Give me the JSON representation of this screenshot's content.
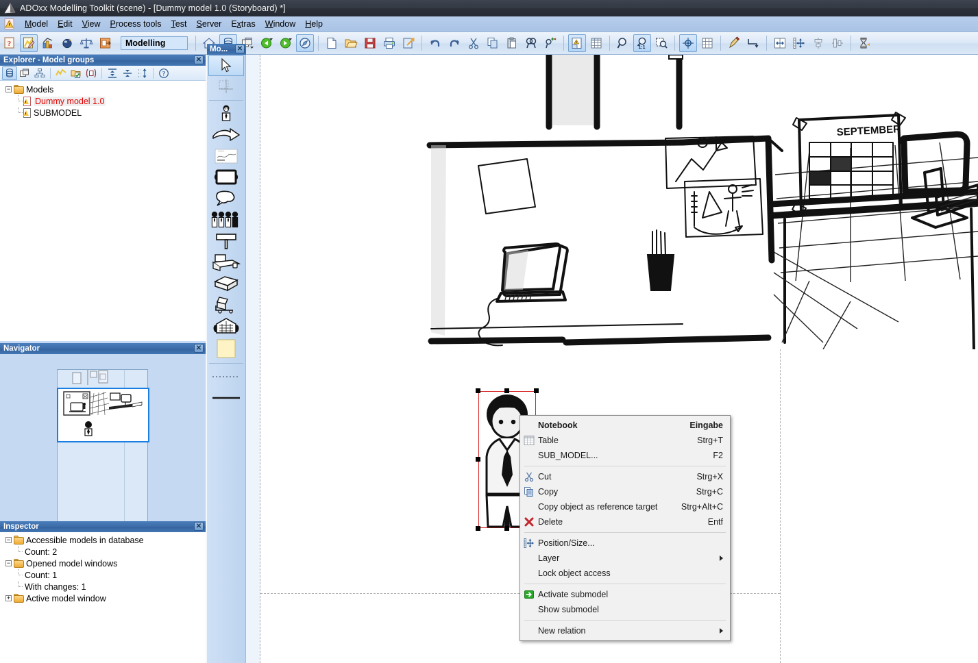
{
  "window": {
    "title": "ADOxx Modelling Toolkit (scene) - [Dummy model 1.0 (Storyboard) *]",
    "app_icon": "adoxx-logo-icon"
  },
  "menubar": {
    "items": [
      {
        "label": "Model",
        "accesskey": "M"
      },
      {
        "label": "Edit",
        "accesskey": "E"
      },
      {
        "label": "View",
        "accesskey": "V"
      },
      {
        "label": "Process tools",
        "accesskey": "P"
      },
      {
        "label": "Test",
        "accesskey": "T"
      },
      {
        "label": "Server",
        "accesskey": "S"
      },
      {
        "label": "Extras",
        "accesskey": "x"
      },
      {
        "label": "Window",
        "accesskey": "W"
      },
      {
        "label": "Help",
        "accesskey": "H"
      }
    ]
  },
  "toolbar": {
    "mode_label": "Modelling",
    "groups": [
      {
        "buttons": [
          {
            "name": "info-component-icon",
            "active": false
          },
          {
            "name": "modelling-component-icon",
            "active": true
          },
          {
            "name": "analysis-component-icon",
            "active": false
          },
          {
            "name": "simulation-component-icon",
            "active": false
          },
          {
            "name": "evaluation-component-icon",
            "active": false
          },
          {
            "name": "import-export-component-icon",
            "active": false
          }
        ]
      },
      {
        "buttons": [
          {
            "name": "home-icon",
            "active": false
          },
          {
            "name": "model-database-icon",
            "active": true
          },
          {
            "name": "model-windows-icon",
            "active": false
          },
          {
            "name": "navigate-back-icon",
            "active": false
          },
          {
            "name": "navigate-forward-icon",
            "active": false
          },
          {
            "name": "navigator-toggle-icon",
            "active": true
          }
        ]
      },
      {
        "buttons": [
          {
            "name": "new-model-icon",
            "active": false
          },
          {
            "name": "open-model-icon",
            "active": false
          },
          {
            "name": "save-model-icon",
            "active": false
          },
          {
            "name": "print-model-icon",
            "active": false
          },
          {
            "name": "export-model-icon",
            "active": false
          }
        ]
      },
      {
        "buttons": [
          {
            "name": "undo-icon",
            "active": false
          },
          {
            "name": "redo-icon",
            "active": false
          },
          {
            "name": "cut-icon",
            "active": false
          },
          {
            "name": "copy-icon",
            "active": false
          },
          {
            "name": "paste-icon",
            "active": false
          },
          {
            "name": "search-icon",
            "active": false
          },
          {
            "name": "replace-icon",
            "active": false
          }
        ]
      },
      {
        "buttons": [
          {
            "name": "notebook-icon",
            "active": true
          },
          {
            "name": "table-view-icon",
            "active": false
          }
        ]
      },
      {
        "buttons": [
          {
            "name": "zoom-icon",
            "active": false
          },
          {
            "name": "zoom-actual-size-icon",
            "active": true
          },
          {
            "name": "zoom-region-icon",
            "active": false
          }
        ]
      },
      {
        "buttons": [
          {
            "name": "snap-to-grid-icon",
            "active": true
          },
          {
            "name": "show-grid-icon",
            "active": false
          }
        ]
      },
      {
        "buttons": [
          {
            "name": "draw-pen-icon",
            "active": false
          },
          {
            "name": "connector-icon",
            "active": false
          }
        ]
      },
      {
        "buttons": [
          {
            "name": "align-width-icon",
            "active": false
          },
          {
            "name": "distribute-icon",
            "active": false
          },
          {
            "name": "align-center-v-icon",
            "active": false
          },
          {
            "name": "align-center-h-icon",
            "active": false
          }
        ]
      },
      {
        "buttons": [
          {
            "name": "generate-report-icon",
            "active": false
          }
        ]
      }
    ]
  },
  "explorer": {
    "caption": "Explorer - Model groups",
    "close_label": "✕",
    "toolbar_buttons": [
      {
        "name": "model-groups-icon",
        "active": true
      },
      {
        "name": "model-windows-icon",
        "active": false
      },
      {
        "name": "model-hierarchy-icon",
        "active": false
      },
      {
        "name": "quick-access-icon",
        "active": false
      },
      {
        "name": "open-model-check-icon",
        "active": false
      },
      {
        "name": "copy-model-icon",
        "active": false
      },
      {
        "name": "expand-all-icon",
        "active": false
      },
      {
        "name": "collapse-all-icon",
        "active": false
      },
      {
        "name": "refresh-tree-icon",
        "active": false
      },
      {
        "name": "help-icon",
        "active": false
      }
    ],
    "tree": [
      {
        "label": "Models",
        "type": "folder",
        "expander": "−",
        "level": 0,
        "selected": false
      },
      {
        "label": "Dummy model 1.0",
        "type": "model",
        "expander": "",
        "level": 1,
        "selected": true
      },
      {
        "label": "SUBMODEL",
        "type": "model",
        "expander": "",
        "level": 1,
        "selected": false
      }
    ]
  },
  "navigator": {
    "caption": "Navigator",
    "close_label": "✕"
  },
  "inspector": {
    "caption": "Inspector",
    "close_label": "✕",
    "tree": [
      {
        "label": "Accessible models in database",
        "type": "folder",
        "expander": "−",
        "level": 0
      },
      {
        "label": "Count: 2",
        "type": "leaf",
        "expander": "",
        "level": 1
      },
      {
        "label": "Opened model windows",
        "type": "folder",
        "expander": "−",
        "level": 0
      },
      {
        "label": "Count: 1",
        "type": "leaf",
        "expander": "",
        "level": 1
      },
      {
        "label": "With changes: 1",
        "type": "leaf",
        "expander": "",
        "level": 1
      },
      {
        "label": "Active model window",
        "type": "folder",
        "expander": "+",
        "level": 0
      }
    ]
  },
  "palette": {
    "caption": "Mo...",
    "close_label": "✕",
    "items": [
      {
        "name": "pointer-tool-icon",
        "selected": true
      },
      {
        "name": "bendpoint-tool-icon",
        "selected": false
      },
      {
        "name": "actor-person-icon",
        "selected": false
      },
      {
        "name": "arrow-shape-icon",
        "selected": false
      },
      {
        "name": "scene-image-icon",
        "selected": false
      },
      {
        "name": "screen-frame-icon",
        "selected": false
      },
      {
        "name": "speech-bubble-icon",
        "selected": false
      },
      {
        "name": "actor-group-icon",
        "selected": false
      },
      {
        "name": "signpost-icon",
        "selected": false
      },
      {
        "name": "workplace-desk-icon",
        "selected": false
      },
      {
        "name": "box-package-icon",
        "selected": false
      },
      {
        "name": "trolley-icon",
        "selected": false
      },
      {
        "name": "building-icon",
        "selected": false
      },
      {
        "name": "sticky-note-icon",
        "selected": false
      },
      {
        "name": "dashed-relation-icon",
        "selected": false
      },
      {
        "name": "solid-relation-icon",
        "selected": false
      }
    ]
  },
  "canvas": {
    "model_name": "Dummy model 1.0 (Storyboard)",
    "selected_object": "actor-person-object",
    "scene_labels": {
      "calendar_month": "SEPTEMBER"
    }
  },
  "context_menu": {
    "sections": [
      {
        "items": [
          {
            "label": "Notebook",
            "accel": "Eingabe",
            "icon": null,
            "bold": true,
            "submenu": false
          },
          {
            "label": "Table",
            "accel": "Strg+T",
            "icon": "table-icon",
            "bold": false,
            "submenu": false
          },
          {
            "label": "SUB_MODEL...",
            "accel": "F2",
            "icon": null,
            "bold": false,
            "submenu": false
          }
        ]
      },
      {
        "items": [
          {
            "label": "Cut",
            "accel": "Strg+X",
            "icon": "scissors-icon",
            "bold": false,
            "submenu": false
          },
          {
            "label": "Copy",
            "accel": "Strg+C",
            "icon": "copy-icon",
            "bold": false,
            "submenu": false
          },
          {
            "label": "Copy object as reference target",
            "accel": "Strg+Alt+C",
            "icon": null,
            "bold": false,
            "submenu": false
          },
          {
            "label": "Delete",
            "accel": "Entf",
            "icon": "delete-x-icon",
            "bold": false,
            "submenu": false
          }
        ]
      },
      {
        "items": [
          {
            "label": "Position/Size...",
            "accel": "",
            "icon": "position-size-icon",
            "bold": false,
            "submenu": false
          },
          {
            "label": "Layer",
            "accel": "",
            "icon": null,
            "bold": false,
            "submenu": true
          },
          {
            "label": "Lock object access",
            "accel": "",
            "icon": null,
            "bold": false,
            "submenu": false
          }
        ]
      },
      {
        "items": [
          {
            "label": "Activate submodel",
            "accel": "",
            "icon": "activate-submodel-icon",
            "bold": false,
            "submenu": false
          },
          {
            "label": "Show submodel",
            "accel": "",
            "icon": null,
            "bold": false,
            "submenu": false
          }
        ]
      },
      {
        "items": [
          {
            "label": "New relation",
            "accel": "",
            "icon": null,
            "bold": false,
            "submenu": true
          }
        ]
      }
    ]
  },
  "colors": {
    "titlebar": "#2b3039",
    "menubar": "#aac4e6",
    "panel_caption": "#3c6ca8",
    "selection_red": "#e10000",
    "dock_background": "#c5daf2",
    "accent_blue": "#1a7fe0"
  }
}
